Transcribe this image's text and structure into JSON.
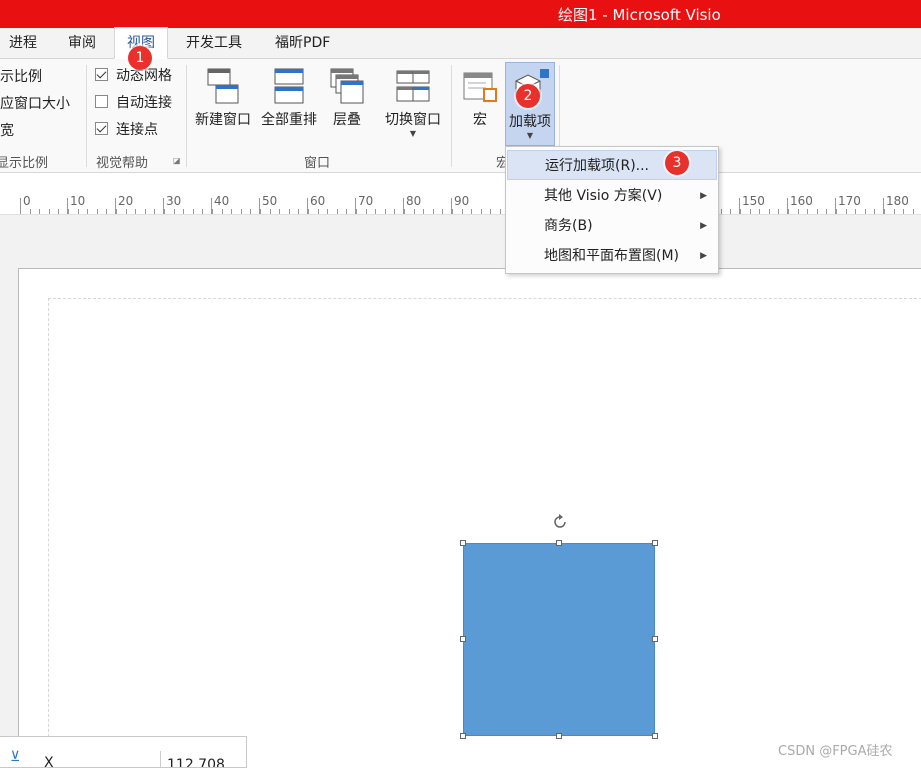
{
  "titlebar": {
    "title": "绘图1 -  Microsoft Visio",
    "color": "#e81010"
  },
  "tabs": [
    {
      "label": "进程"
    },
    {
      "label": "审阅"
    },
    {
      "label": "视图",
      "active": true
    },
    {
      "label": "开发工具"
    },
    {
      "label": "福昕PDF"
    }
  ],
  "ribbon": {
    "zoom_group": {
      "items": [
        "示比例",
        "应窗口大小",
        "宽"
      ],
      "name": "显示比例"
    },
    "visual_aids": {
      "checkboxes": [
        {
          "label": "动态网格",
          "checked": true
        },
        {
          "label": "自动连接",
          "checked": false
        },
        {
          "label": "连接点",
          "checked": true
        }
      ],
      "name": "视觉帮助"
    },
    "window_group": {
      "buttons": [
        "新建窗口",
        "全部重排",
        "层叠",
        "切换窗口"
      ],
      "name": "窗口"
    },
    "macro_group": {
      "buttons": [
        "宏",
        "加载项"
      ],
      "name": "宏"
    }
  },
  "badges": [
    "1",
    "2",
    "3"
  ],
  "addins_menu": {
    "items": [
      {
        "label": "运行加载项(R)...",
        "submenu": false,
        "highlighted": true
      },
      {
        "label": "其他 Visio 方案(V)",
        "submenu": true
      },
      {
        "label": "商务(B)",
        "submenu": true
      },
      {
        "label": "地图和平面布置图(M)",
        "submenu": true
      }
    ]
  },
  "ruler": {
    "labels": [
      "0",
      "10",
      "20",
      "30",
      "40",
      "50",
      "60",
      "70",
      "80",
      "90",
      "150",
      "160",
      "170",
      "180"
    ]
  },
  "shape": {
    "fill": "#5b9bd5"
  },
  "size_panel": {
    "icon": "width-icon",
    "label": "X",
    "value": "112.708"
  },
  "watermark": "CSDN @FPGA硅农"
}
